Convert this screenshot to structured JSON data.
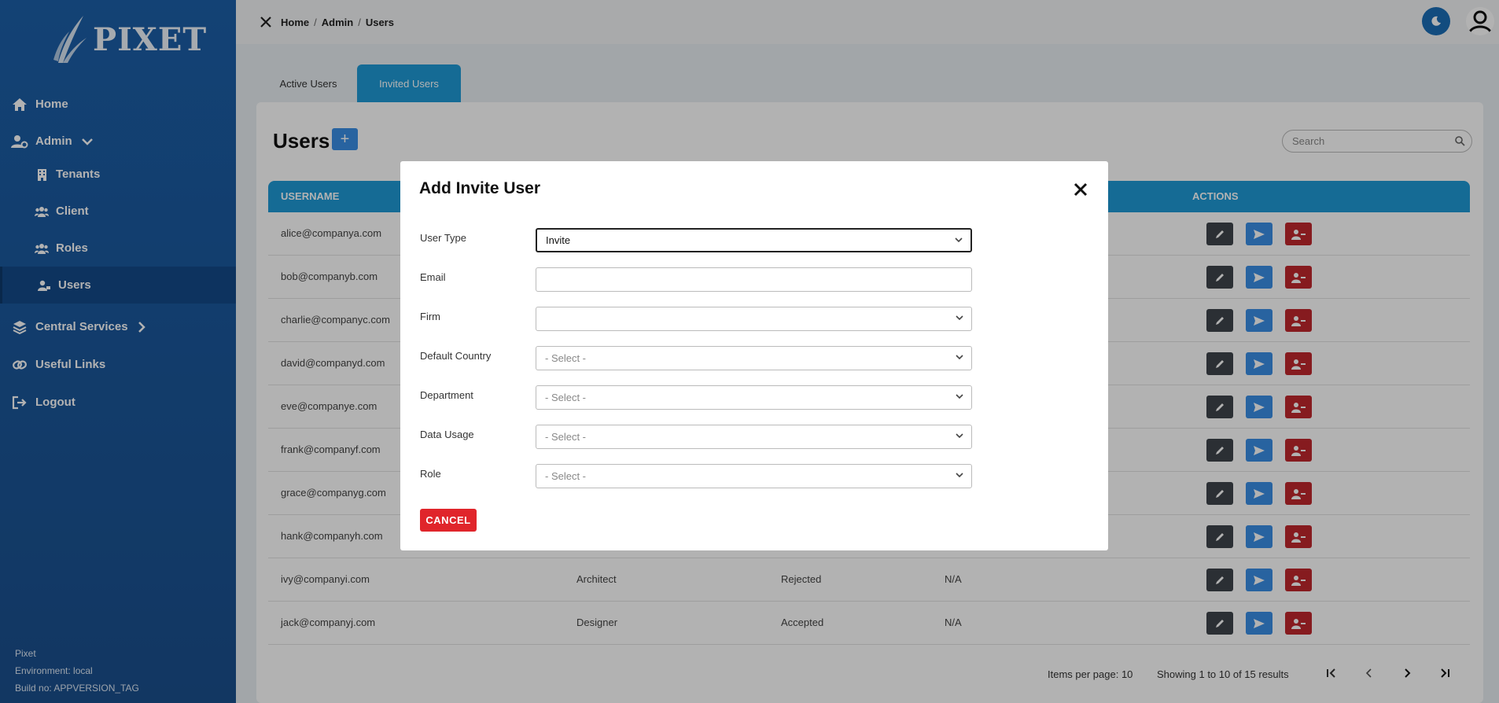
{
  "app": {
    "logo_text": "PIXET"
  },
  "sidebar": {
    "items": [
      {
        "label": "Home",
        "icon": "home-icon"
      },
      {
        "label": "Admin",
        "icon": "user-gear-icon"
      },
      {
        "label": "Tenants",
        "icon": "building-icon"
      },
      {
        "label": "Client",
        "icon": "users-icon"
      },
      {
        "label": "Roles",
        "icon": "users-icon"
      },
      {
        "label": "Users",
        "icon": "user-icon"
      },
      {
        "label": "Central Services",
        "icon": "layers-icon"
      },
      {
        "label": "Useful Links",
        "icon": "link-icon"
      },
      {
        "label": "Logout",
        "icon": "logout-icon"
      }
    ],
    "footer": {
      "name": "Pixet",
      "environment": "Environment: local",
      "build": "Build no: APPVERSION_TAG"
    }
  },
  "breadcrumb": {
    "items": [
      "Home",
      "Admin",
      "Users"
    ]
  },
  "tabs": [
    {
      "label": "Active Users"
    },
    {
      "label": "Invited Users",
      "active": true
    }
  ],
  "page": {
    "title": "Users",
    "add_label": "+",
    "search_placeholder": "Search"
  },
  "table": {
    "columns": [
      "USERNAME",
      "ACTIONS"
    ],
    "rows": [
      {
        "username": "alice@companya.com",
        "col2": "",
        "col3": "",
        "col4": ""
      },
      {
        "username": "bob@companyb.com",
        "col2": "",
        "col3": "",
        "col4": ""
      },
      {
        "username": "charlie@companyc.com",
        "col2": "",
        "col3": "",
        "col4": ""
      },
      {
        "username": "david@companyd.com",
        "col2": "",
        "col3": "",
        "col4": ""
      },
      {
        "username": "eve@companye.com",
        "col2": "",
        "col3": "",
        "col4": ""
      },
      {
        "username": "frank@companyf.com",
        "col2": "",
        "col3": "",
        "col4": ""
      },
      {
        "username": "grace@companyg.com",
        "col2": "",
        "col3": "",
        "col4": ""
      },
      {
        "username": "hank@companyh.com",
        "col2": "",
        "col3": "",
        "col4": ""
      },
      {
        "username": "ivy@companyi.com",
        "col2": "Architect",
        "col3": "Rejected",
        "col4": "N/A"
      },
      {
        "username": "jack@companyj.com",
        "col2": "Designer",
        "col3": "Accepted",
        "col4": "N/A"
      }
    ]
  },
  "pagination": {
    "items_per_page": "Items per page: 10",
    "showing": "Showing 1 to 10 of 15 results"
  },
  "modal": {
    "title": "Add Invite User",
    "fields": [
      {
        "label": "User Type",
        "value": "Invite",
        "type": "select"
      },
      {
        "label": "Email",
        "value": "",
        "type": "input"
      },
      {
        "label": "Firm",
        "value": "",
        "type": "select"
      },
      {
        "label": "Default Country",
        "value": "- Select -",
        "type": "select"
      },
      {
        "label": "Department",
        "value": "- Select -",
        "type": "select"
      },
      {
        "label": "Data Usage",
        "value": "- Select -",
        "type": "select"
      },
      {
        "label": "Role",
        "value": "- Select -",
        "type": "select"
      }
    ],
    "cancel_label": "CANCEL"
  },
  "colors": {
    "sidebar": "#1c5fa8",
    "accent": "#1f9ad6",
    "danger": "#e0252b",
    "edit": "#3e444b",
    "send": "#3a8ee6"
  }
}
